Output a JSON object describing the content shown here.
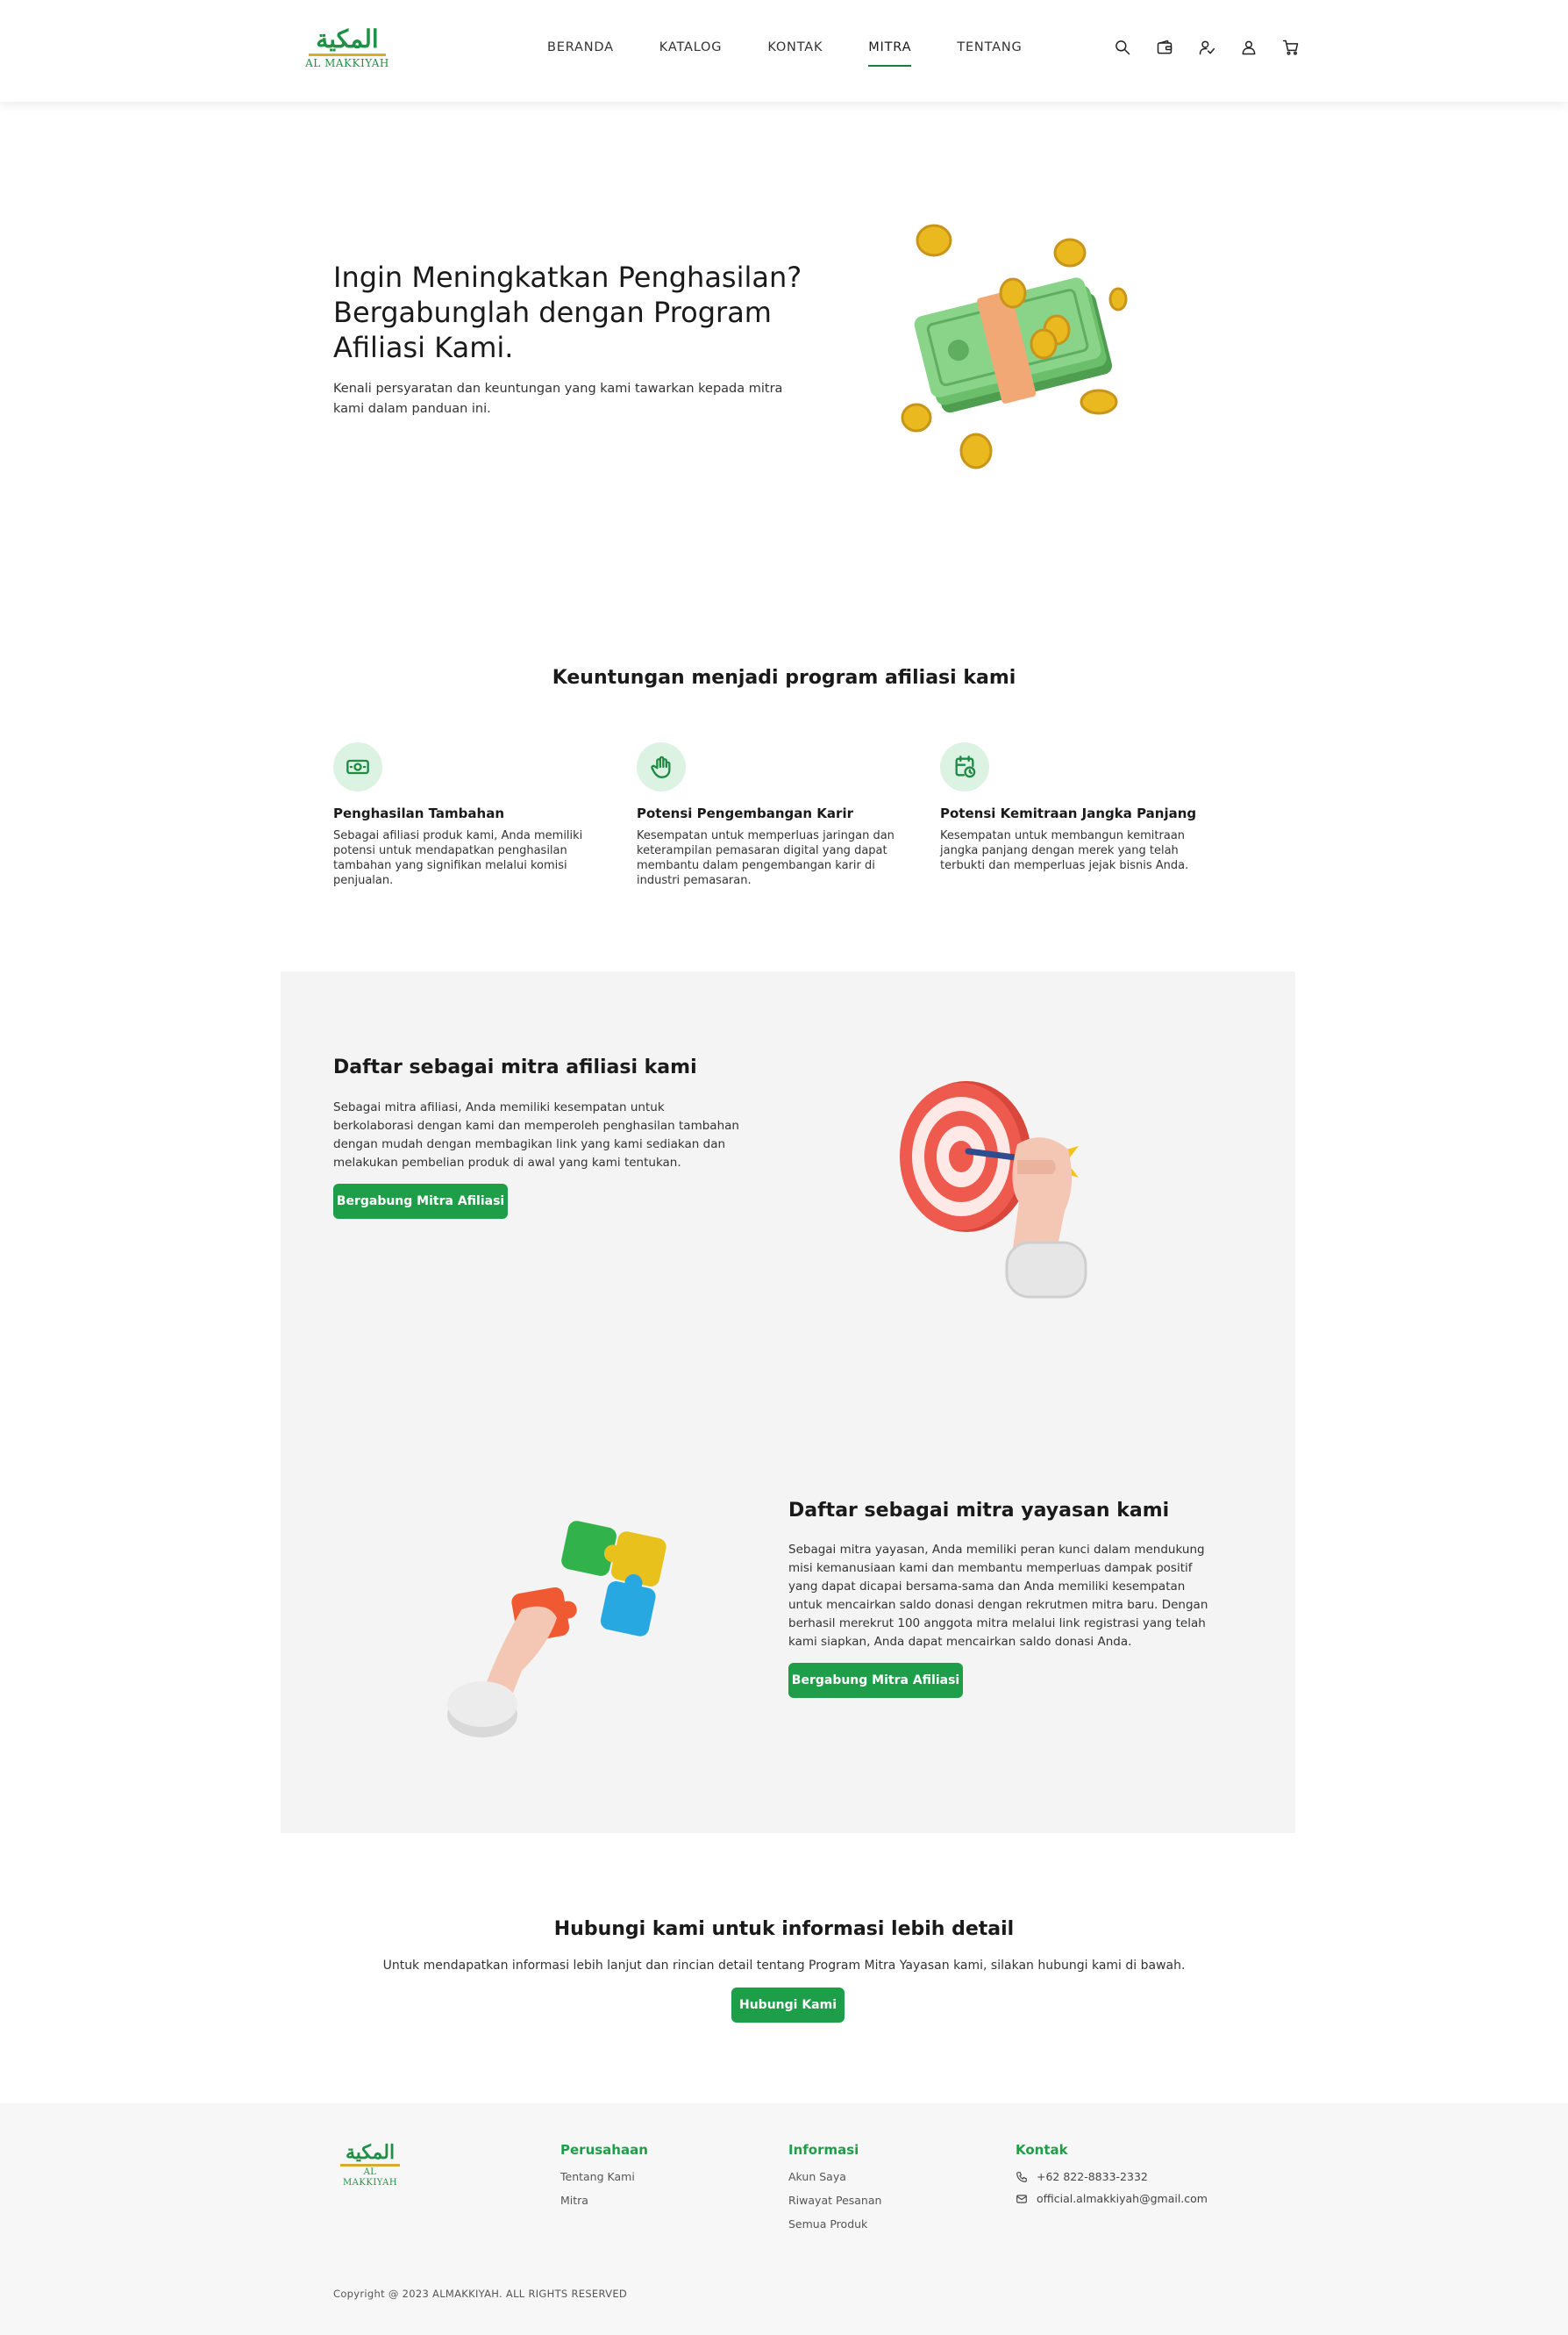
{
  "header": {
    "logo_arabic": "المكية",
    "logo_text": "AL MAKKIYAH",
    "nav": [
      {
        "label": "BERANDA"
      },
      {
        "label": "KATALOG"
      },
      {
        "label": "KONTAK"
      },
      {
        "label": "MITRA",
        "active": true
      },
      {
        "label": "TENTANG"
      }
    ],
    "icons": [
      "search-icon",
      "wallet-icon",
      "affiliate-user-icon",
      "account-icon",
      "cart-icon"
    ]
  },
  "hero": {
    "title": "Ingin Meningkatkan Penghasilan? Bergabunglah dengan Program Afiliasi Kami.",
    "subtitle": "Kenali persyaratan dan keuntungan yang kami tawarkan kepada mitra kami dalam panduan ini."
  },
  "benefits": {
    "title": "Keuntungan menjadi program afiliasi kami",
    "items": [
      {
        "icon": "money-icon",
        "title": "Penghasilan Tambahan",
        "text": "Sebagai afiliasi produk kami, Anda memiliki potensi untuk mendapatkan penghasilan tambahan yang signifikan melalui komisi penjualan."
      },
      {
        "icon": "hand-icon",
        "title": "Potensi Pengembangan Karir",
        "text": "Kesempatan untuk memperluas jaringan dan keterampilan pemasaran digital yang dapat membantu dalam pengembangan karir di industri pemasaran."
      },
      {
        "icon": "calendar-clock-icon",
        "title": "Potensi Kemitraan Jangka Panjang",
        "text": "Kesempatan untuk membangun kemitraan jangka panjang dengan merek yang telah terbukti dan memperluas jejak bisnis Anda."
      }
    ]
  },
  "affiliate": {
    "title": "Daftar sebagai mitra afiliasi kami",
    "text": "Sebagai mitra afiliasi, Anda memiliki kesempatan untuk berkolaborasi dengan kami dan memperoleh penghasilan tambahan dengan mudah dengan membagikan link yang kami sediakan dan melakukan pembelian produk di awal yang kami tentukan.",
    "button": "Bergabung Mitra Afiliasi"
  },
  "foundation": {
    "title": "Daftar sebagai mitra yayasan kami",
    "text": "Sebagai mitra yayasan, Anda memiliki peran kunci dalam mendukung misi kemanusiaan kami dan membantu memperluas dampak positif yang dapat dicapai bersama-sama dan Anda memiliki kesempatan untuk mencairkan saldo donasi dengan rekrutmen mitra baru. Dengan berhasil merekrut 100 anggota mitra melalui link registrasi yang telah kami siapkan, Anda dapat mencairkan saldo donasi Anda.",
    "button": "Bergabung Mitra Afiliasi"
  },
  "contact": {
    "title": "Hubungi kami untuk informasi lebih detail",
    "text": "Untuk mendapatkan informasi lebih lanjut dan rincian detail tentang Program Mitra Yayasan kami, silakan hubungi kami di bawah.",
    "button": "Hubungi Kami"
  },
  "footer": {
    "logo_arabic": "المكية",
    "logo_text": "AL MAKKIYAH",
    "company": {
      "title": "Perusahaan",
      "links": [
        "Tentang Kami",
        "Mitra"
      ]
    },
    "info": {
      "title": "Informasi",
      "links": [
        "Akun Saya",
        "Riwayat Pesanan",
        "Semua Produk"
      ]
    },
    "contact": {
      "title": "Kontak",
      "phone": "+62 822-8833-2332",
      "email": "official.almakkiyah@gmail.com"
    },
    "copyright": "Copyright @ 2023 ALMAKKIYAH.  ALL RIGHTS RESERVED"
  },
  "colors": {
    "accent": "#1f9e4a",
    "accent_light": "#dcf2e2",
    "panel": "#f4f4f4",
    "logo_gold": "#d5ad2b"
  }
}
